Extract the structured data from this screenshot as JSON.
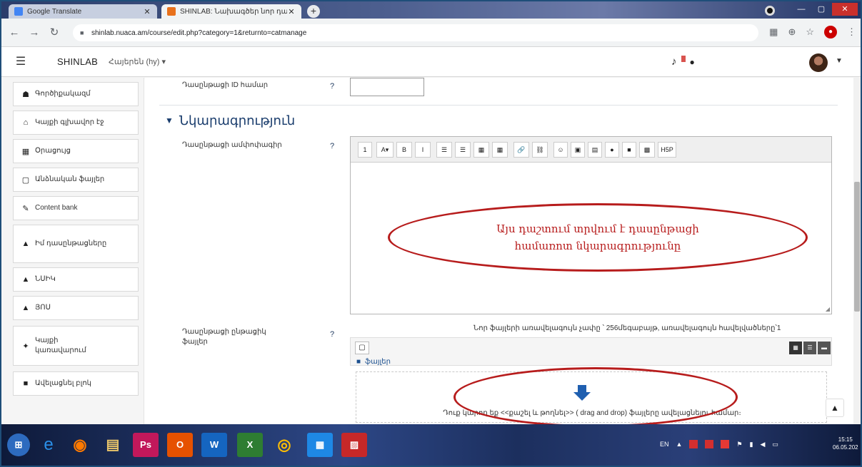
{
  "browser": {
    "tabs": [
      {
        "title": "Google Translate",
        "active": false
      },
      {
        "title": "SHINLAB: Նախագծեր նոր դասընթաց",
        "active": true
      }
    ],
    "new_tab_symbol": "+",
    "url": "shinlab.nuaca.am/course/edit.php?category=1&returnto=catmanage"
  },
  "navbar": {
    "brand": "SHINLAB",
    "language": "Հայերեն (hy) ▾"
  },
  "sidebar": {
    "items": [
      {
        "label": "Գործիքակազմ",
        "icon": "dashboard-icon",
        "glyph": "☗"
      },
      {
        "label": "Կայքի գլխավոր էջ",
        "icon": "home-icon",
        "glyph": "⌂"
      },
      {
        "label": "Օրացույց",
        "icon": "calendar-icon",
        "glyph": "▦"
      },
      {
        "label": "Անձնական ֆայլեր",
        "icon": "file-icon",
        "glyph": "▢"
      },
      {
        "label": "Content bank",
        "icon": "pencil-icon",
        "glyph": "✎"
      },
      {
        "label": "Իմ դասընթացները",
        "icon": "graduation-cap-icon",
        "glyph": "▲"
      },
      {
        "label": "ՆՍԻԿ",
        "icon": "graduation-cap-icon",
        "glyph": "▲"
      },
      {
        "label": "ՅՈՍ",
        "icon": "graduation-cap-icon",
        "glyph": "▲"
      },
      {
        "label": "Կայքի կառավարում",
        "icon": "wrench-icon",
        "glyph": "✦"
      },
      {
        "label": "Ավելացնել բլոկ",
        "icon": "plus-square-icon",
        "glyph": "■"
      }
    ]
  },
  "form": {
    "course_id_label": "Դասընթացի ID համար",
    "section_title": "Նկարագրություն",
    "summary_label": "Դասընթացի ամփոփագիր",
    "summary_callout": [
      "Այս դաշտում տրվում է դասընթացի",
      "համառոտ նկարագրությունը"
    ],
    "files_label_line1": "Դասընթացի ընթացիկ",
    "files_label_line2": "ֆայլեր",
    "max_files_info": "Նոր ֆայլերի առավելագույն չափը ՝ 256մեգաբայթ, առավելագույն հավելվածները՝1",
    "files_folder": "ֆայլեր",
    "drop_text": "Դուք կարող եք <<քաշել և թողնել>> ( drag and drop) ֆայլերը ավելացնելու համար։",
    "editor_buttons": [
      "1",
      "A▾",
      "B",
      "I",
      "☰",
      "☰",
      "▦",
      "▦",
      "🔗",
      "⛓",
      "☺",
      "▣",
      "▤",
      "●",
      "■",
      "▩",
      "H5P"
    ]
  },
  "taskbar": {
    "apps": [
      "e",
      "◉",
      "▤",
      "Ps",
      "O",
      "W",
      "X",
      "◎",
      "▦",
      "▨"
    ],
    "lang": "EN",
    "time": "15:15",
    "date": "06.05.202"
  }
}
